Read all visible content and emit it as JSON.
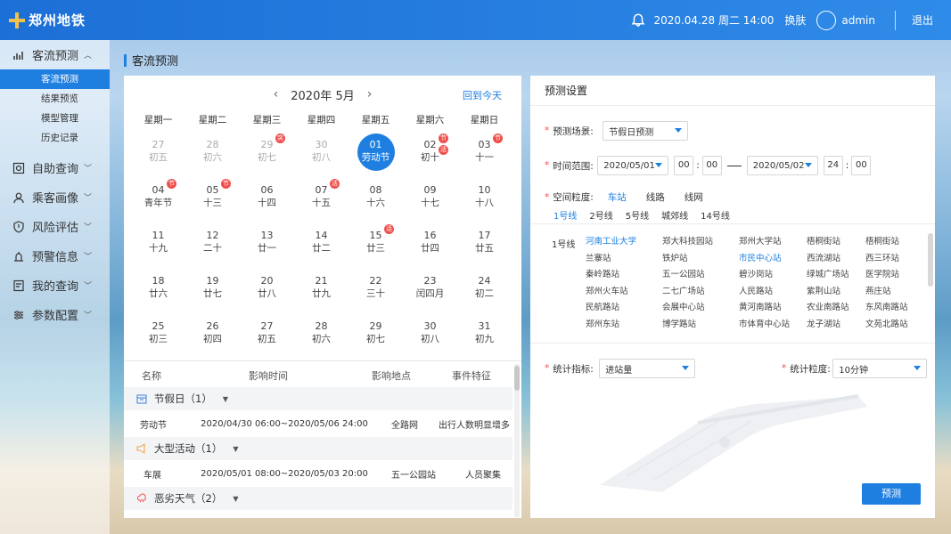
{
  "app": {
    "logo_text": "郑州地铁",
    "datetime": "2020.04.28  周二  14:00",
    "theme_label": "换肤",
    "user": "admin",
    "logout_label": "退出"
  },
  "sidebar": {
    "items": [
      {
        "label": "客流预测",
        "icon": "bar-chart-icon",
        "expanded": true
      },
      {
        "label": "自助查询",
        "icon": "search-icon"
      },
      {
        "label": "乘客画像",
        "icon": "user-icon"
      },
      {
        "label": "风险评估",
        "icon": "shield-icon"
      },
      {
        "label": "预警信息",
        "icon": "alert-icon"
      },
      {
        "label": "我的查询",
        "icon": "document-icon"
      },
      {
        "label": "参数配置",
        "icon": "settings-icon"
      }
    ],
    "subitems": [
      {
        "label": "客流预测",
        "active": true
      },
      {
        "label": "结果预览"
      },
      {
        "label": "模型管理"
      },
      {
        "label": "历史记录"
      }
    ]
  },
  "page": {
    "title": "客流预测"
  },
  "calendar": {
    "month_label": "2020年  5月",
    "prev": "‹",
    "next": "›",
    "today_label": "回到今天",
    "weekdays": [
      "星期一",
      "星期二",
      "星期三",
      "星期四",
      "星期五",
      "星期六",
      "星期日"
    ],
    "weeks": [
      [
        {
          "d": "27",
          "l": "初五",
          "m": true
        },
        {
          "d": "28",
          "l": "初六",
          "m": true
        },
        {
          "d": "29",
          "l": "初七",
          "m": true,
          "b": "突"
        },
        {
          "d": "30",
          "l": "初八",
          "m": true
        },
        {
          "d": "01",
          "l": "劳动节",
          "s": true
        },
        {
          "d": "02",
          "l": "初十",
          "b": "节",
          "b2": "活"
        },
        {
          "d": "03",
          "l": "十一",
          "b": "节"
        }
      ],
      [
        {
          "d": "04",
          "l": "青年节",
          "b": "节"
        },
        {
          "d": "05",
          "l": "十三",
          "b": "节"
        },
        {
          "d": "06",
          "l": "十四"
        },
        {
          "d": "07",
          "l": "十五",
          "b": "活"
        },
        {
          "d": "08",
          "l": "十六"
        },
        {
          "d": "09",
          "l": "十七"
        },
        {
          "d": "10",
          "l": "十八"
        }
      ],
      [
        {
          "d": "11",
          "l": "十九"
        },
        {
          "d": "12",
          "l": "二十"
        },
        {
          "d": "13",
          "l": "廿一"
        },
        {
          "d": "14",
          "l": "廿二"
        },
        {
          "d": "15",
          "l": "廿三",
          "b": "活"
        },
        {
          "d": "16",
          "l": "廿四"
        },
        {
          "d": "17",
          "l": "廿五"
        }
      ],
      [
        {
          "d": "18",
          "l": "廿六"
        },
        {
          "d": "19",
          "l": "廿七"
        },
        {
          "d": "20",
          "l": "廿八"
        },
        {
          "d": "21",
          "l": "廿九"
        },
        {
          "d": "22",
          "l": "三十"
        },
        {
          "d": "23",
          "l": "闰四月"
        },
        {
          "d": "24",
          "l": "初二"
        }
      ],
      [
        {
          "d": "25",
          "l": "初三"
        },
        {
          "d": "26",
          "l": "初四"
        },
        {
          "d": "27",
          "l": "初五"
        },
        {
          "d": "28",
          "l": "初六"
        },
        {
          "d": "29",
          "l": "初七"
        },
        {
          "d": "30",
          "l": "初八"
        },
        {
          "d": "31",
          "l": "初九"
        }
      ]
    ]
  },
  "events": {
    "columns": [
      "名称",
      "影响时间",
      "影响地点",
      "事件特征"
    ],
    "groups": [
      {
        "title": "节假日（1）",
        "icon": "calendar-icon",
        "color": "#3a7fd8",
        "rows": [
          [
            "劳动节",
            "2020/04/30  06:00~2020/05/06  24:00",
            "全路网",
            "出行人数明显增多"
          ]
        ]
      },
      {
        "title": "大型活动（1）",
        "icon": "megaphone-icon",
        "color": "#f2a23a",
        "rows": [
          [
            "车展",
            "2020/05/01  08:00~2020/05/03  20:00",
            "五一公园站",
            "人员聚集"
          ]
        ]
      },
      {
        "title": "恶劣天气（2）",
        "icon": "weather-icon",
        "color": "#f0504c",
        "rows": []
      }
    ]
  },
  "settings": {
    "title": "预测设置",
    "scene_label": "预测场景:",
    "scene_value": "节假日预测",
    "time_label": "时间范围:",
    "start_date": "2020/05/01",
    "start_h": "00",
    "start_m": "00",
    "end_date": "2020/05/02",
    "end_h": "24",
    "end_m": "00",
    "granularity_label": "空间粒度:",
    "granularity_options": [
      "车站",
      "线路",
      "线网"
    ],
    "line_tabs": [
      "1号线",
      "2号线",
      "5号线",
      "城郊线",
      "14号线"
    ],
    "station_line": "1号线",
    "stations": [
      "河南工业大学",
      "郑大科技园站",
      "郑州大学站",
      "梧桐街站",
      "梧桐街站",
      "兰寨站",
      "铁炉站",
      "市民中心站",
      "西流湖站",
      "西三环站",
      "秦岭路站",
      "五一公园站",
      "碧沙岗站",
      "绿城广场站",
      "医学院站",
      "郑州火车站",
      "二七广场站",
      "人民路站",
      "紫荆山站",
      "燕庄站",
      "民航路站",
      "会展中心站",
      "黄河南路站",
      "农业南路站",
      "东风南路站",
      "郑州东站",
      "博学路站",
      "市体育中心站",
      "龙子湖站",
      "文苑北路站"
    ],
    "metric_label": "统计指标:",
    "metric_value": "进站量",
    "time_gran_label": "统计粒度:",
    "time_gran_value": "10分钟",
    "predict_button": "预测"
  }
}
